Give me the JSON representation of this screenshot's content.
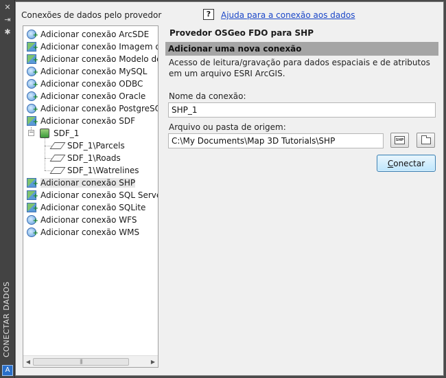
{
  "palette": {
    "vertical_title": "CONECTAR DADOS",
    "close_icon": "close-icon",
    "pin_icon": "pin-icon",
    "settings_icon": "settings-icon",
    "logo_icon": "autocad-logo-icon"
  },
  "header": {
    "providers_title": "Conexões de dados pelo provedor",
    "help_icon_glyph": "?",
    "help_link": "Ajuda para a conexão aos dados"
  },
  "tree": {
    "items": [
      {
        "label": "Adicionar conexão ArcSDE",
        "icon": "globe-add-icon"
      },
      {
        "label": "Adicionar conexão Imagem ou s",
        "icon": "raster-add-icon"
      },
      {
        "label": "Adicionar conexão Modelo de ir",
        "icon": "raster-add-icon"
      },
      {
        "label": "Adicionar conexão MySQL",
        "icon": "globe-add-icon"
      },
      {
        "label": "Adicionar conexão ODBC",
        "icon": "globe-add-icon"
      },
      {
        "label": "Adicionar conexão Oracle",
        "icon": "globe-add-icon"
      },
      {
        "label": "Adicionar conexão PostgreSQL",
        "icon": "globe-add-icon"
      },
      {
        "label": "Adicionar conexão SDF",
        "icon": "raster-add-icon"
      }
    ],
    "sdf_node": {
      "label": "SDF_1",
      "expander": "−"
    },
    "sdf_children": [
      {
        "label": "SDF_1\\Parcels"
      },
      {
        "label": "SDF_1\\Roads"
      },
      {
        "label": "SDF_1\\Watrelines"
      }
    ],
    "items_after": [
      {
        "label": "Adicionar conexão SHP",
        "icon": "raster-add-icon",
        "selected": true
      },
      {
        "label": "Adicionar conexão SQL Server Sp",
        "icon": "raster-add-icon"
      },
      {
        "label": "Adicionar conexão SQLite",
        "icon": "raster-add-icon"
      },
      {
        "label": "Adicionar conexão WFS",
        "icon": "globe-add-icon"
      },
      {
        "label": "Adicionar conexão WMS",
        "icon": "globe-add-icon"
      }
    ],
    "scroll_left": "◀",
    "scroll_right": "▶",
    "scroll_grip": "|||"
  },
  "detail": {
    "provider_title": "Provedor OSGeo FDO para SHP",
    "section_header": "Adicionar uma nova conexão",
    "description": "Acesso de leitura/gravação para dados espaciais e de atributos em um arquivo ESRI ArcGIS.",
    "connection_name_label": "Nome da conexão:",
    "connection_name_value": "SHP_1",
    "source_label": "Arquivo ou pasta de origem:",
    "source_value": "C:\\My Documents\\Map 3D Tutorials\\SHP",
    "shp_button_glyph": "SHP",
    "connect_button_underlined": "C",
    "connect_button_rest": "onectar"
  }
}
